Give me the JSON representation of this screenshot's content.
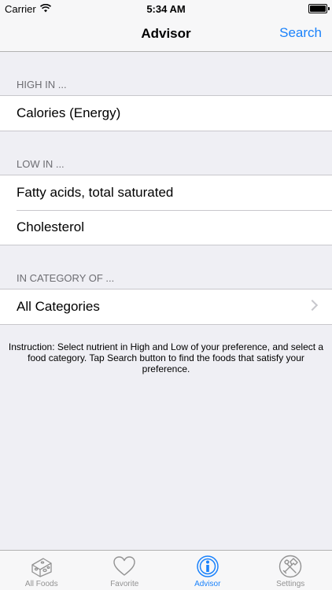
{
  "status_bar": {
    "carrier": "Carrier",
    "time": "5:34 AM"
  },
  "nav": {
    "title": "Advisor",
    "search_label": "Search"
  },
  "sections": {
    "high": {
      "header": "HIGH IN ...",
      "items": [
        "Calories (Energy)"
      ]
    },
    "low": {
      "header": "LOW IN ...",
      "items": [
        "Fatty acids, total saturated",
        "Cholesterol"
      ]
    },
    "category": {
      "header": "IN CATEGORY OF ...",
      "items": [
        "All Categories"
      ]
    }
  },
  "instruction": "Instruction: Select nutrient in High and Low of your preference, and select a food category.  Tap Search button to find the foods that satisfy your preference.",
  "tabs": [
    {
      "label": "All Foods",
      "icon": "cheese-icon",
      "active": false
    },
    {
      "label": "Favorite",
      "icon": "heart-icon",
      "active": false
    },
    {
      "label": "Advisor",
      "icon": "advisor-icon",
      "active": true
    },
    {
      "label": "Settings",
      "icon": "tools-icon",
      "active": false
    }
  ],
  "colors": {
    "accent": "#1a82fb",
    "inactive": "#929292",
    "background": "#efeff4"
  }
}
